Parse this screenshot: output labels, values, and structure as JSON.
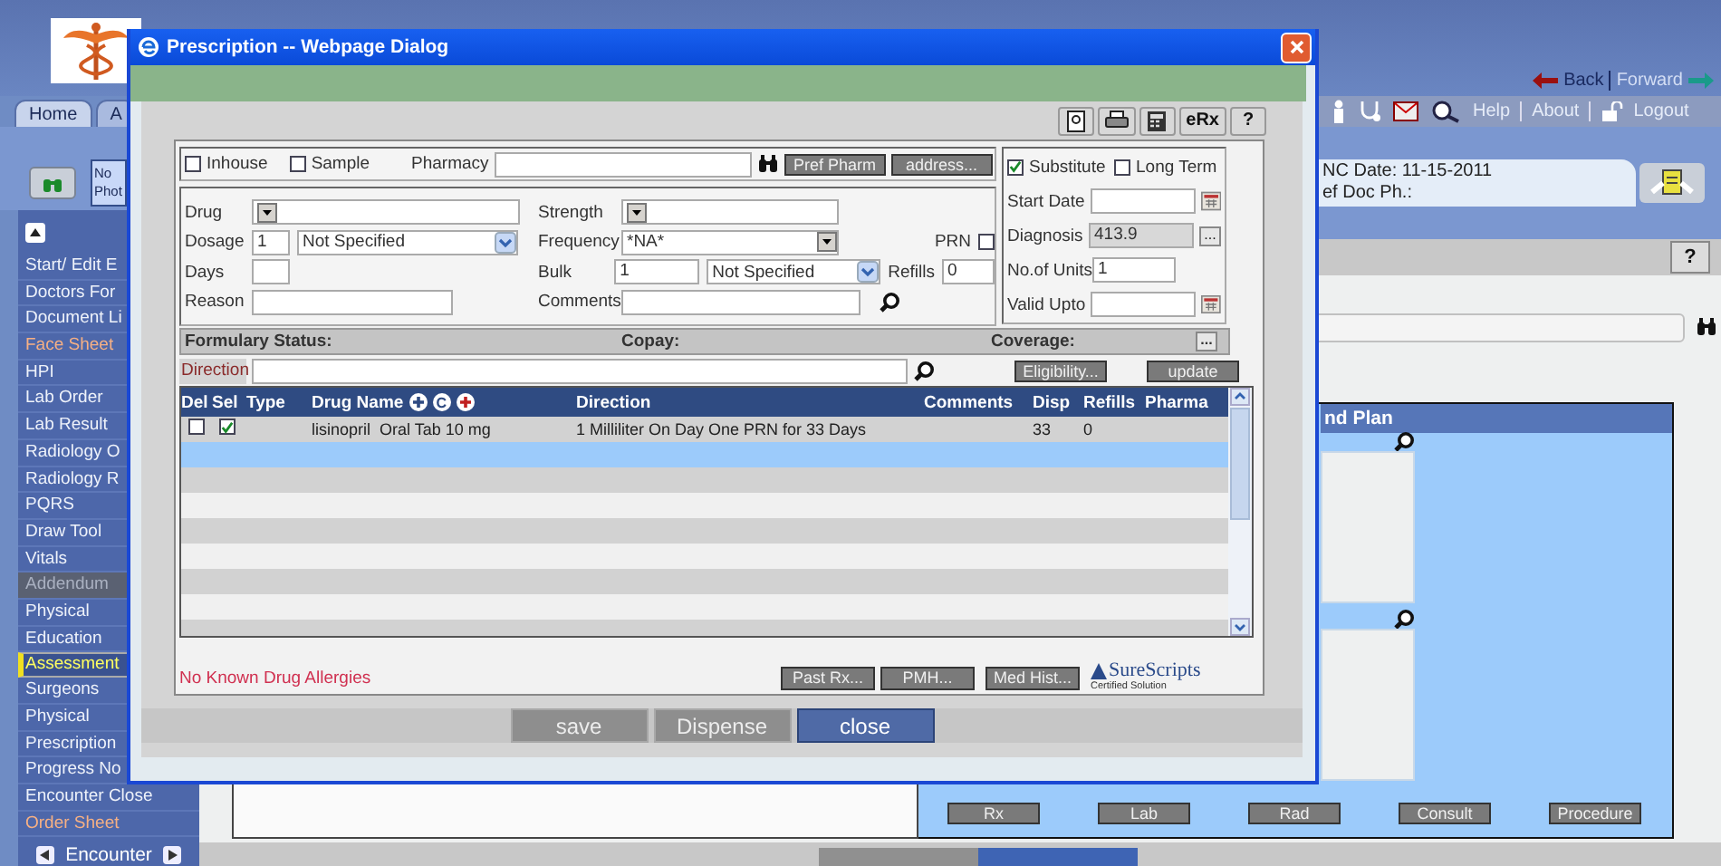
{
  "app": {
    "nav": {
      "back": "Back",
      "forward": "Forward"
    },
    "tabs": [
      {
        "label": "Home",
        "selected": true
      },
      {
        "label": "A",
        "selected": false
      }
    ],
    "toolbar_links": [
      "Help",
      "About",
      "Logout"
    ],
    "patient": {
      "photo": "No Phot",
      "lines": [
        "NC Date: 11-15-2011",
        "ef Doc Ph.:"
      ]
    },
    "sidebar": {
      "items": [
        {
          "label": "Start/ Edit E",
          "kind": "normal",
          "selected": false
        },
        {
          "label": "Doctors For",
          "kind": "normal",
          "selected": false
        },
        {
          "label": "Document Li",
          "kind": "normal",
          "selected": false
        },
        {
          "label": "Face Sheet",
          "kind": "visited",
          "selected": false
        },
        {
          "label": "HPI",
          "kind": "normal",
          "selected": false
        },
        {
          "label": "Lab Order",
          "kind": "normal",
          "selected": false
        },
        {
          "label": "Lab Result",
          "kind": "normal",
          "selected": false
        },
        {
          "label": "Radiology O",
          "kind": "normal",
          "selected": false
        },
        {
          "label": "Radiology R",
          "kind": "normal",
          "selected": false
        },
        {
          "label": "PQRS",
          "kind": "normal",
          "selected": false
        },
        {
          "label": "Draw Tool",
          "kind": "normal",
          "selected": false
        },
        {
          "label": "Vitals",
          "kind": "normal",
          "selected": false
        },
        {
          "label": "Addendum",
          "kind": "disabled",
          "selected": false
        },
        {
          "label": "Physical",
          "kind": "normal",
          "selected": false
        },
        {
          "label": "Education",
          "kind": "normal",
          "selected": false
        },
        {
          "label": "Assessment",
          "kind": "normal",
          "selected": true
        },
        {
          "label": "Surgeons",
          "kind": "normal",
          "selected": false
        },
        {
          "label": "Physical",
          "kind": "normal",
          "selected": false
        },
        {
          "label": "Prescription",
          "kind": "normal",
          "selected": false
        },
        {
          "label": "Progress No",
          "kind": "normal",
          "selected": false
        },
        {
          "label": "Encounter Close",
          "kind": "normal",
          "selected": false
        },
        {
          "label": "Order Sheet",
          "kind": "visited",
          "selected": false
        }
      ],
      "footer": "Encounter"
    },
    "help_button": "?",
    "panel": {
      "title": "nd Plan",
      "buttons": [
        "Rx",
        "Lab",
        "Rad",
        "Consult",
        "Procedure"
      ]
    }
  },
  "dialog": {
    "title": "Prescription -- Webpage Dialog",
    "toolbar": [
      "eRx",
      "?"
    ],
    "options": [
      {
        "label": "Inhouse",
        "checked": false
      },
      {
        "label": "Sample",
        "checked": false
      }
    ],
    "pharmacy": {
      "label": "Pharmacy",
      "buttons": [
        "Pref Pharm",
        "address..."
      ]
    },
    "drug_form": {
      "drug_label": "Drug",
      "dosage_label": "Dosage",
      "dosage": "1",
      "dosage_unit": "Not Specified",
      "days_label": "Days",
      "reason_label": "Reason",
      "strength_label": "Strength",
      "frequency_label": "Frequency",
      "frequency": "*NA*",
      "bulk_label": "Bulk",
      "bulk": "1",
      "bulk_unit": "Not Specified",
      "comments_label": "Comments",
      "prn": {
        "label": "PRN",
        "checked": false
      },
      "refills_label": "Refills",
      "refills": "0"
    },
    "side_form": {
      "substitute": {
        "label": "Substitute",
        "checked": true
      },
      "long_term": {
        "label": "Long Term",
        "checked": false
      },
      "start_date_label": "Start Date",
      "diagnosis_label": "Diagnosis",
      "diagnosis": "413.9",
      "diagnosis_button": "...",
      "units_label": "No.of Units",
      "units": "1",
      "valid_upto_label": "Valid Upto"
    },
    "formulary": {
      "status": "Formulary Status:",
      "copay": "Copay:",
      "coverage": "Coverage:",
      "button": "..."
    },
    "direction": {
      "label": "Direction",
      "buttons": [
        "Eligibility...",
        "update"
      ]
    },
    "table": {
      "columns": [
        "Del",
        "Sel",
        "Type",
        "Drug Name",
        "Direction",
        "Comments",
        "Disp",
        "Refills",
        "Pharma"
      ],
      "header_button": "C",
      "rows": [
        {
          "del": false,
          "sel": true,
          "drug_name": "lisinopril  Oral Tab 10 mg",
          "direction": "1 Milliliter On Day One PRN for 33 Days",
          "disp": "33",
          "refills": "0"
        }
      ]
    },
    "allergies": "No Known Drug Allergies",
    "history_buttons": [
      "Past Rx...",
      "PMH...",
      "Med Hist..."
    ],
    "surescripts": {
      "name": "SureScripts",
      "tagline": "Certified Solution"
    },
    "actions": [
      {
        "label": "save",
        "disabled": true
      },
      {
        "label": "Dispense",
        "disabled": true
      },
      {
        "label": "close",
        "disabled": false
      }
    ]
  }
}
